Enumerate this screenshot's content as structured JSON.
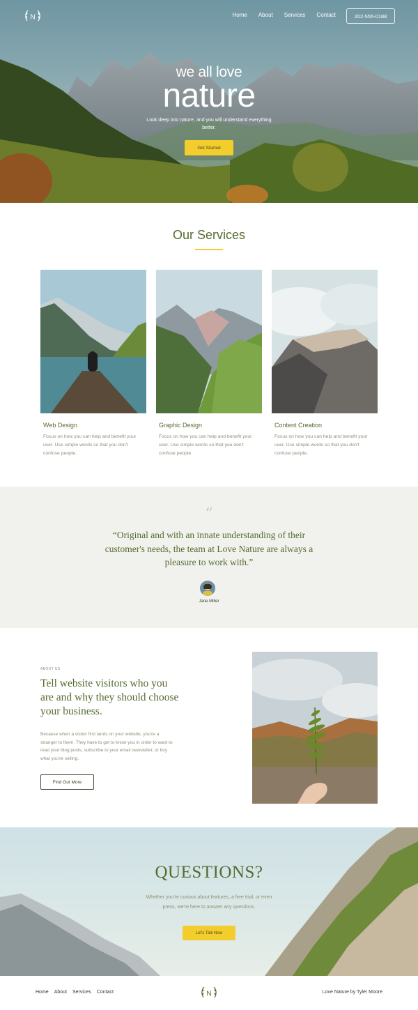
{
  "header": {
    "logo_letter": "N",
    "nav": [
      "Home",
      "About",
      "Services",
      "Contact"
    ],
    "phone": "202-555-0188"
  },
  "hero": {
    "line1": "we all love",
    "line2": "nature",
    "subtitle": "Look deep into nature, and you will understand everything better.",
    "cta": "Get Started"
  },
  "services": {
    "title": "Our Services",
    "cards": [
      {
        "title": "Web Design",
        "text": "Focus on how you can help and benefit your user. Use simple words so that you don't confuse people."
      },
      {
        "title": "Graphic Design",
        "text": "Focus on how you can help and benefit your user. Use simple words so that you don't confuse people."
      },
      {
        "title": "Content Creation",
        "text": "Focus on how you can help and benefit your user. Use simple words so that you don't confuse people."
      }
    ]
  },
  "testimonial": {
    "quote_mark": "“",
    "text": "“Original and with an innate understanding of their customer's needs, the team at Love Nature are always a pleasure to work with.”",
    "author": "Jane Miller"
  },
  "about": {
    "eyebrow": "ABOUT US",
    "title": "Tell website visitors who you are and why they should choose your business.",
    "body": "Because when a visitor first lands on your website, you're a stranger to them. They have to get to know you in order to want to read your blog posts, subscribe to your email newsletter, or buy what you're selling.",
    "button": "Find Out More"
  },
  "questions": {
    "title": "QUESTIONS?",
    "subtitle": "Whether you're curious about features, a free trial, or even press, we're here to answer any questions.",
    "cta": "Let's Talk Now"
  },
  "footer": {
    "nav": [
      "Home",
      "About",
      "Services",
      "Contact"
    ],
    "logo_letter": "N",
    "credit": "Love Nature by Tyler Moore"
  },
  "colors": {
    "accent_yellow": "#f2cd2c",
    "olive_text": "#556b2f",
    "muted_text": "#8a9078",
    "testimonial_bg": "#f1f2ee"
  }
}
